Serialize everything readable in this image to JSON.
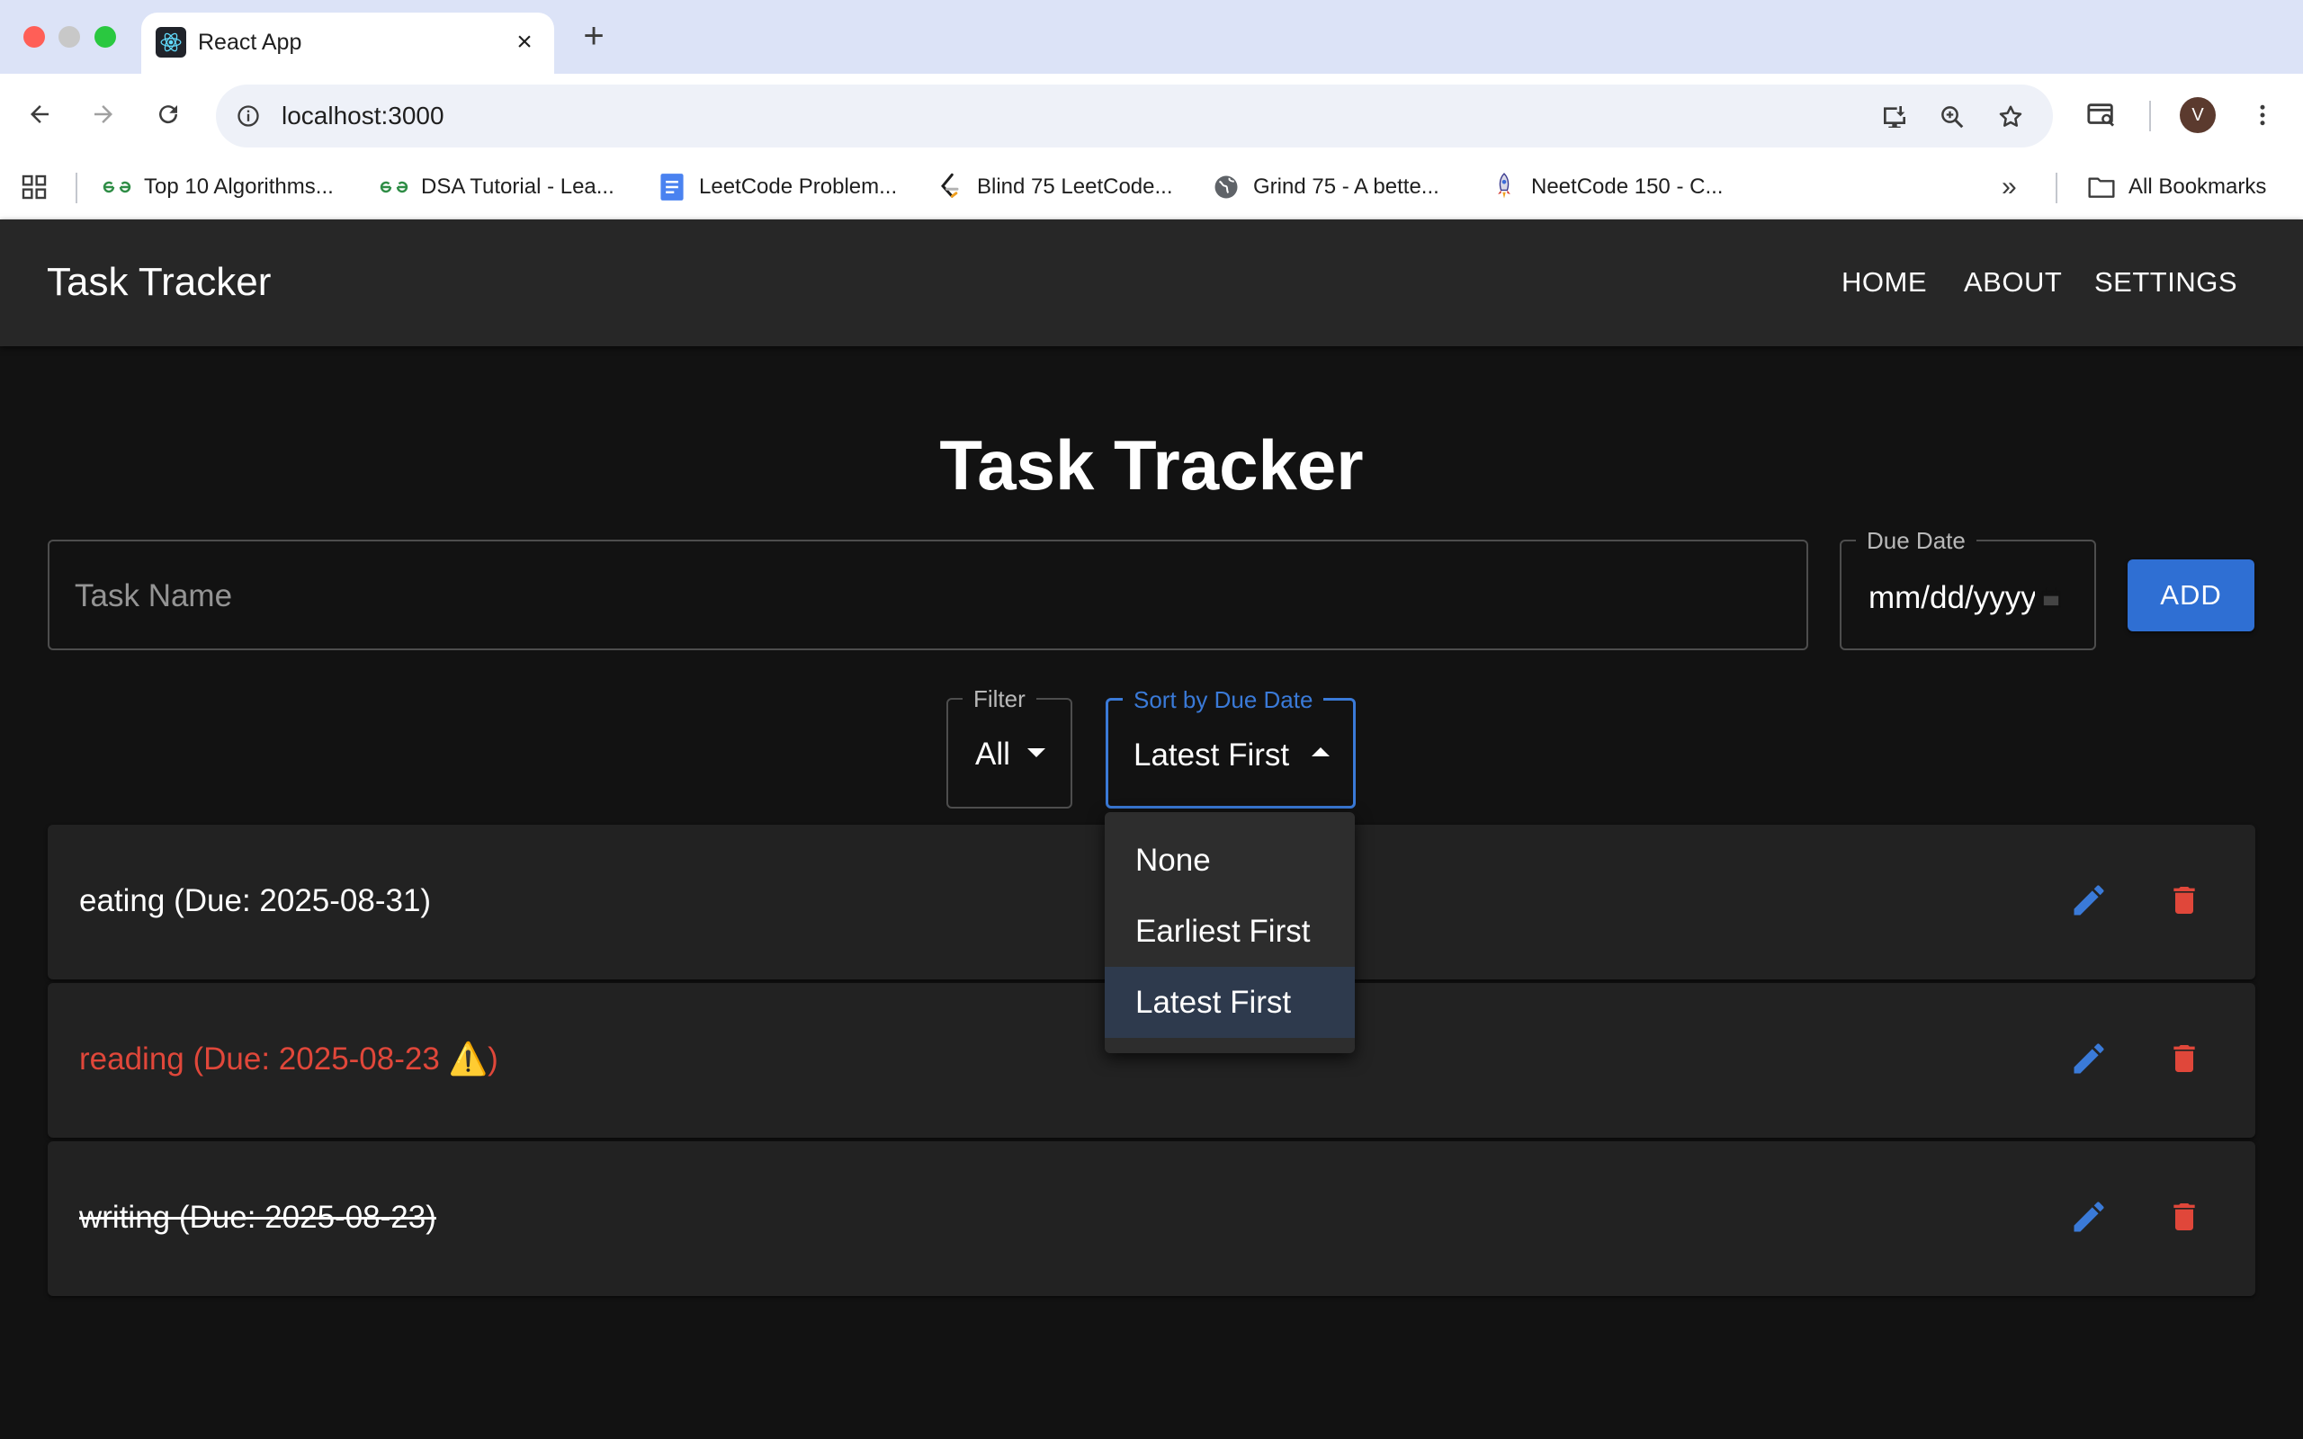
{
  "browser": {
    "tab_title": "React App",
    "url": "localhost:3000",
    "avatar_letter": "V",
    "bookmarks": [
      {
        "label": "Top 10 Algorithms...",
        "icon": "geeksforgeeks-icon"
      },
      {
        "label": "DSA Tutorial - Lea...",
        "icon": "geeksforgeeks-icon"
      },
      {
        "label": "LeetCode Problem...",
        "icon": "google-docs-icon"
      },
      {
        "label": "Blind 75 LeetCode...",
        "icon": "leetcode-icon"
      },
      {
        "label": "Grind 75 - A bette...",
        "icon": "globe-icon"
      },
      {
        "label": "NeetCode 150 - C...",
        "icon": "rocket-icon"
      }
    ],
    "all_bookmarks_label": "All Bookmarks"
  },
  "app": {
    "brand": "Task Tracker",
    "nav": [
      "HOME",
      "ABOUT",
      "SETTINGS"
    ],
    "title": "Task Tracker",
    "task_input_placeholder": "Task Name",
    "due_date_label": "Due Date",
    "due_date_value": "mm/dd/yyyy",
    "add_label": "ADD",
    "filter_label": "Filter",
    "filter_value": "All",
    "sort_label": "Sort by Due Date",
    "sort_value": "Latest First",
    "sort_options": [
      "None",
      "Earliest First",
      "Latest First"
    ],
    "sort_selected_index": 2,
    "tasks": [
      {
        "text": "eating (Due: 2025-08-31)",
        "status": "normal"
      },
      {
        "text": "reading (Due: 2025-08-23 ⚠️)",
        "status": "overdue"
      },
      {
        "text": "writing (Due: 2025-08-23)",
        "status": "completed"
      }
    ]
  },
  "colors": {
    "accent": "#2f6fd3",
    "danger": "#e0473a",
    "edit_icon": "#3a7ad8",
    "background": "#121212",
    "appbar": "#272727"
  }
}
